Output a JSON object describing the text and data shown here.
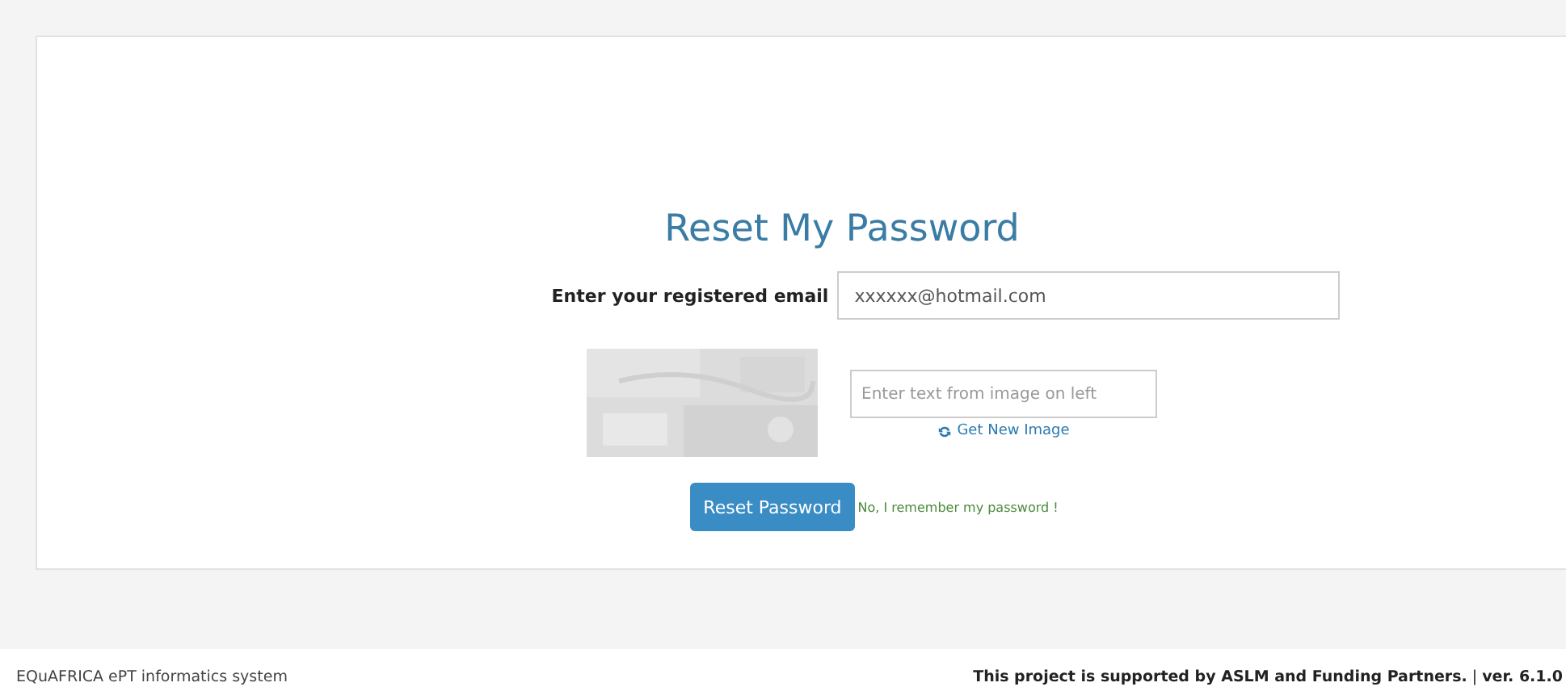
{
  "title": "Reset My Password",
  "email": {
    "label": "Enter your registered email",
    "value": "xxxxxx@hotmail.com"
  },
  "captcha": {
    "placeholder": "Enter text from image on left",
    "refresh_link": "Get New Image"
  },
  "submit_button": "Reset Password",
  "back_link": "No, I remember my password !",
  "footer": {
    "left": "EQuAFRICA ePT informatics system",
    "right": "This project is supported by ASLM and Funding Partners.",
    "separator": "|",
    "version": "ver. 6.1.0"
  }
}
